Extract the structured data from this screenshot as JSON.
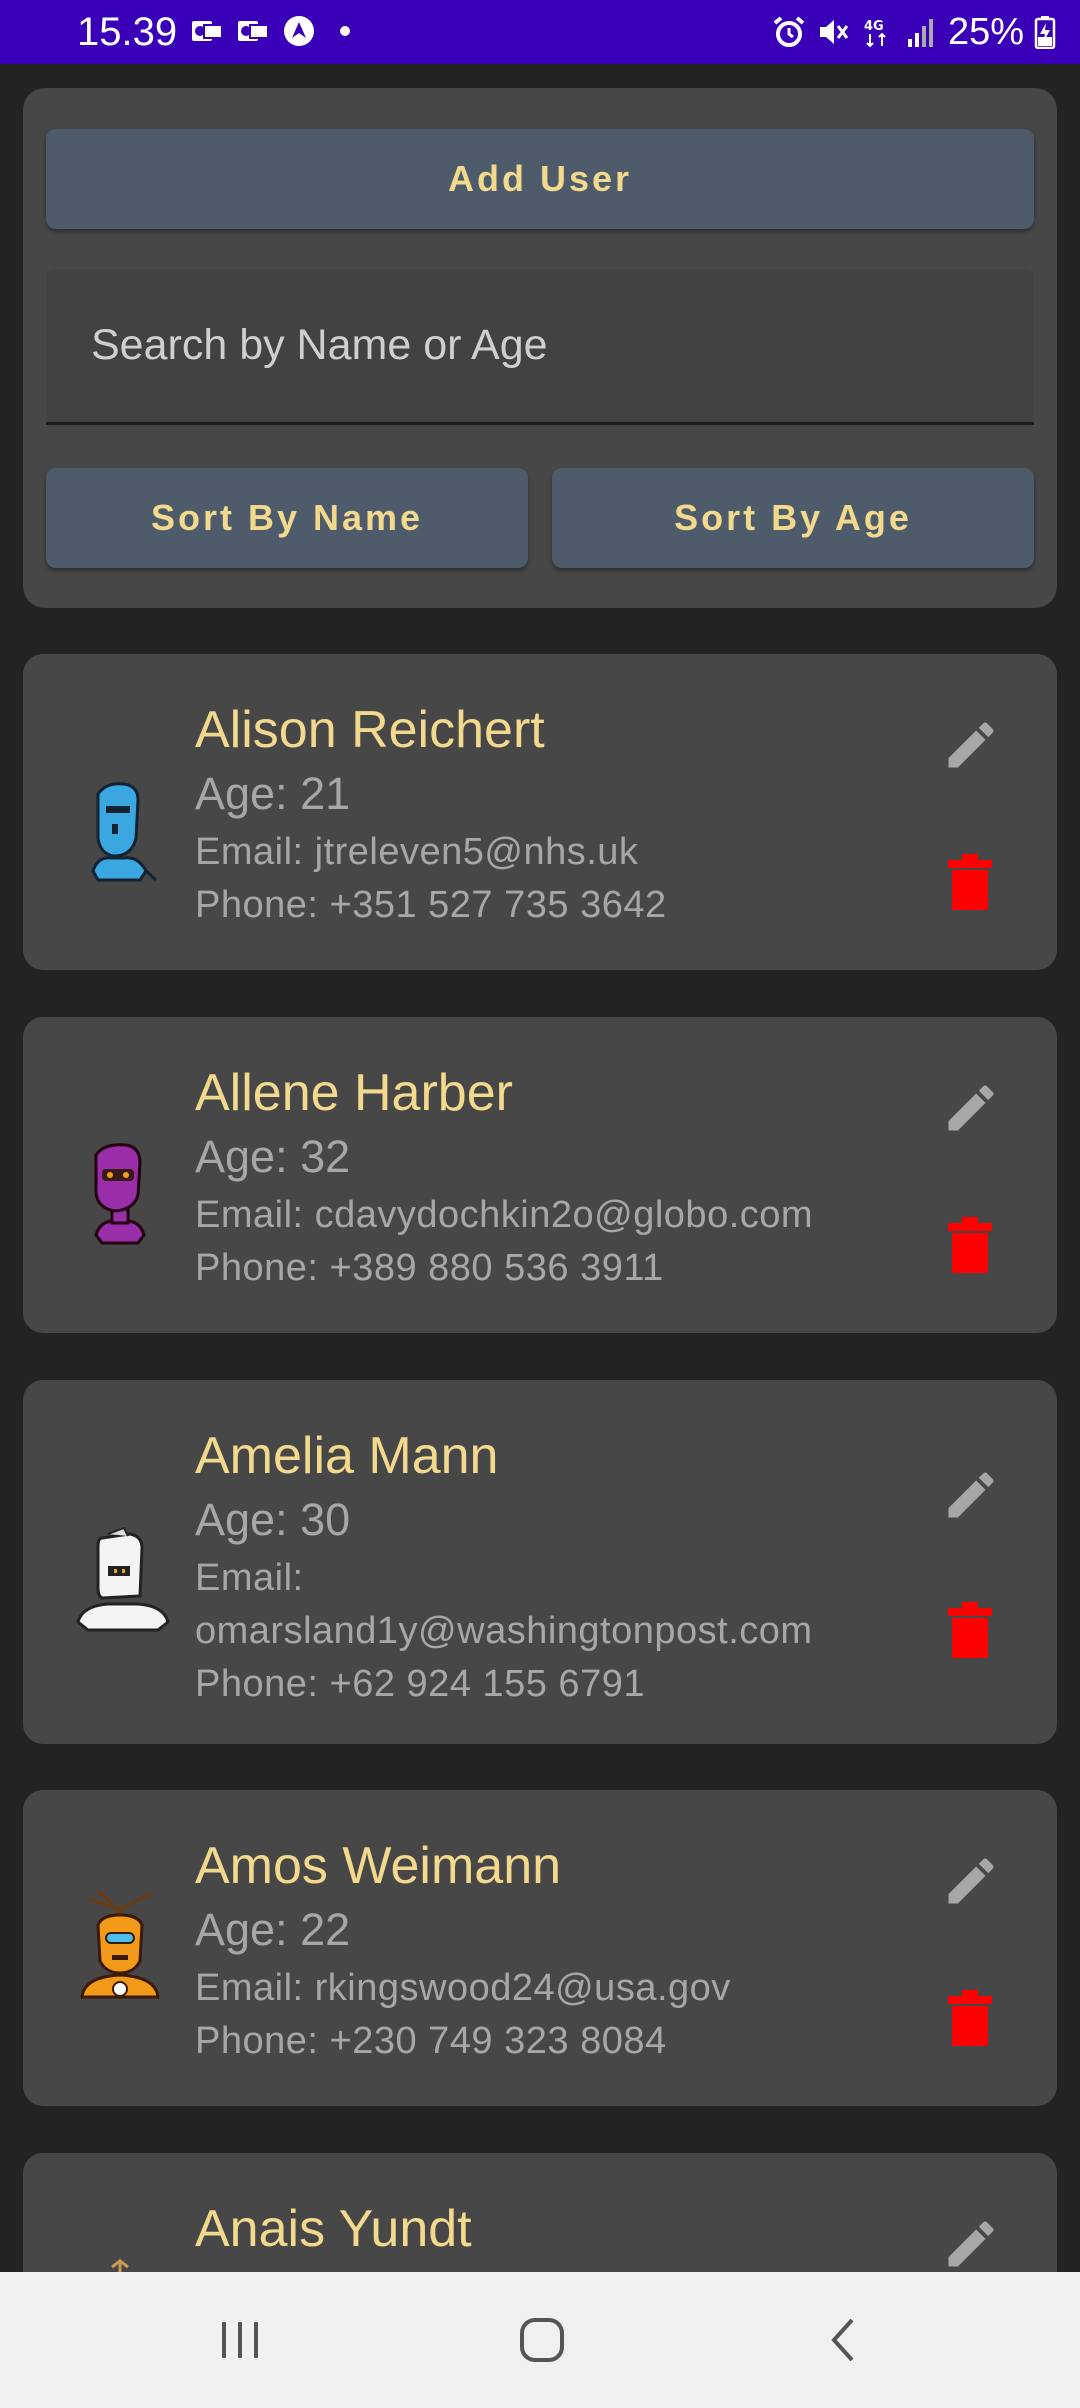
{
  "status_bar": {
    "time": "15.39",
    "battery": "25%",
    "network": "4G"
  },
  "controls": {
    "add_user_label": "Add User",
    "search_placeholder": "Search by Name or Age",
    "sort_by_name_label": "Sort By Name",
    "sort_by_age_label": "Sort By Age"
  },
  "users": [
    {
      "name": "Alison Reichert",
      "age": "Age: 21",
      "email": "Email: jtreleven5@nhs.uk",
      "phone": "Phone: +351 527 735 3642",
      "avatar_icon": "robot-blue-icon"
    },
    {
      "name": "Allene Harber",
      "age": "Age: 32",
      "email": "Email: cdavydochkin2o@globo.com",
      "phone": "Phone: +389 880 536 3911",
      "avatar_icon": "robot-purple-icon"
    },
    {
      "name": "Amelia Mann",
      "age": "Age: 30",
      "email_label": "Email:",
      "email_value": "omarsland1y@washingtonpost.com",
      "phone": "Phone: +62 924 155 6791",
      "avatar_icon": "robot-white-icon"
    },
    {
      "name": "Amos Weimann",
      "age": "Age: 22",
      "email": "Email: rkingswood24@usa.gov",
      "phone": "Phone: +230 749 323 8084",
      "avatar_icon": "robot-orange-icon"
    },
    {
      "name": "Anais Yundt",
      "avatar_icon": "robot-icon"
    }
  ],
  "colors": {
    "status_bar": "#3a00b8",
    "background": "#232323",
    "card": "#474747",
    "button": "#4d5b6a",
    "accent_text": "#f3d98e",
    "secondary_text": "#a7a7a7",
    "delete": "#ff0000"
  }
}
